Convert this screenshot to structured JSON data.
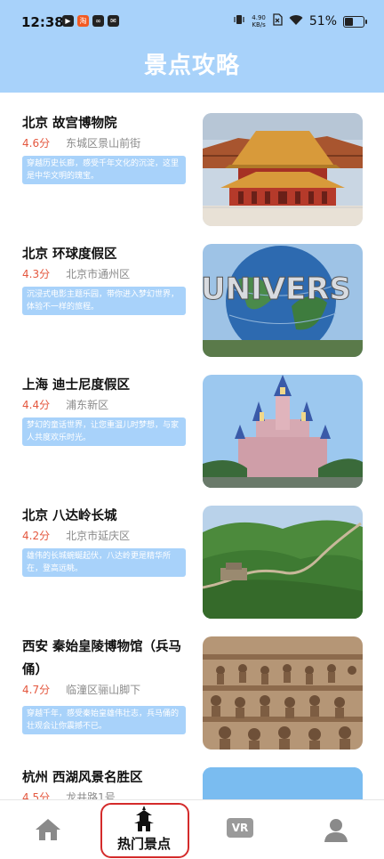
{
  "status": {
    "time": "12:38",
    "net_speed_value": "4.90",
    "net_speed_unit": "KB/s",
    "battery": "51%",
    "battery_level": 0.51
  },
  "header": {
    "title": "景点攻略"
  },
  "attractions": [
    {
      "title": "北京  故宫博物院",
      "rating": "4.6分",
      "address": "东城区景山前街",
      "desc": "穿越历史长廊，感受千年文化的沉淀，这里是中华文明的瑰宝。"
    },
    {
      "title": "北京  环球度假区",
      "rating": "4.3分",
      "address": "北京市通州区",
      "desc": "沉浸式电影主题乐园，带你进入梦幻世界，体验不一样的旅程。",
      "image_text": "UNIVERS"
    },
    {
      "title": "上海  迪士尼度假区",
      "rating": "4.4分",
      "address": "浦东新区",
      "desc": "梦幻的童话世界，让您重温儿时梦想，与家人共度欢乐时光。"
    },
    {
      "title": "北京  八达岭长城",
      "rating": "4.2分",
      "address": "北京市延庆区",
      "desc": "雄伟的长城蜿蜒起伏，八达岭更是精华所在，登高远眺。"
    },
    {
      "title": "西安  秦始皇陵博物馆（兵马俑）",
      "rating": "4.7分",
      "address": "临潼区骊山脚下",
      "desc": "穿越千年，感受秦始皇雄伟壮志，兵马俑的壮观会让你震撼不已。"
    },
    {
      "title": "杭州  西湖风景名胜区",
      "rating": "4.5分",
      "address": "龙井路1号",
      "desc": ""
    }
  ],
  "tabbar": {
    "tabs": [
      {
        "label": "",
        "icon": "home-icon"
      },
      {
        "label": "热门景点",
        "icon": "pagoda-icon"
      },
      {
        "label": "VR",
        "icon": "vr-icon"
      },
      {
        "label": "",
        "icon": "user-icon"
      }
    ],
    "active_tab": 1,
    "highlight_color": "#d42b2b"
  },
  "colors": {
    "accent": "#a8d2fa",
    "rating": "#e4573e",
    "address": "#8a8a8a"
  }
}
